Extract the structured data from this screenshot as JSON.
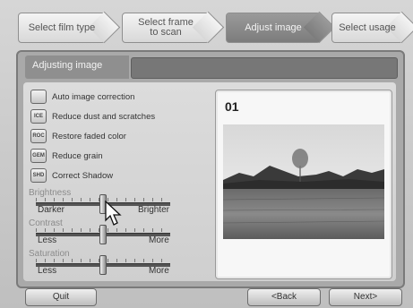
{
  "wizard": {
    "steps": [
      {
        "label": "Select film type"
      },
      {
        "label": "Select frame\nto scan"
      },
      {
        "label": "Adjust image"
      },
      {
        "label": "Select usage"
      }
    ],
    "active_step": 2
  },
  "panel": {
    "title": "Adjusting image"
  },
  "options": [
    {
      "label": "Auto image correction",
      "icon": "auto-correction-icon",
      "glyph": ""
    },
    {
      "label": "Reduce dust and scratches",
      "icon": "ice-icon",
      "glyph": "ICE"
    },
    {
      "label": "Restore faded color",
      "icon": "roc-icon",
      "glyph": "ROC"
    },
    {
      "label": "Reduce grain",
      "icon": "gem-icon",
      "glyph": "GEM"
    },
    {
      "label": "Correct Shadow",
      "icon": "shd-icon",
      "glyph": "SHD"
    }
  ],
  "sliders": [
    {
      "title": "Brightness",
      "min_label": "Darker",
      "max_label": "Brighter",
      "value": 0.5
    },
    {
      "title": "Contrast",
      "min_label": "Less",
      "max_label": "More",
      "value": 0.5
    },
    {
      "title": "Saturation",
      "min_label": "Less",
      "max_label": "More",
      "value": 0.5
    }
  ],
  "preview": {
    "frame_number": "01"
  },
  "buttons": {
    "quit": "Quit",
    "back": "<Back",
    "next": "Next>"
  }
}
